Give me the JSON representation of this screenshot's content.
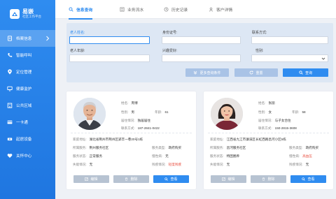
{
  "app": {
    "name": "易嵌",
    "subtitle": "社区工作平台"
  },
  "sidebar": {
    "items": [
      {
        "label": "档案信息",
        "icon": "file-icon",
        "active": true
      },
      {
        "label": "智能呼叫",
        "icon": "phone-icon"
      },
      {
        "label": "定位管理",
        "icon": "location-icon"
      },
      {
        "label": "健康监护",
        "icon": "monitor-icon"
      },
      {
        "label": "公共区域",
        "icon": "building-icon"
      },
      {
        "label": "一卡通",
        "icon": "card-icon"
      },
      {
        "label": "起居设备",
        "icon": "device-icon"
      },
      {
        "label": "关怀中心",
        "icon": "heart-icon"
      }
    ]
  },
  "tabs": [
    {
      "label": "信息查询",
      "icon": "search-icon",
      "active": true
    },
    {
      "label": "业务流水",
      "icon": "list-icon"
    },
    {
      "label": "历史记录",
      "icon": "clock-icon"
    },
    {
      "label": "客户详情",
      "icon": "user-icon"
    }
  ],
  "search": {
    "fields": {
      "name": {
        "label": "老人姓名:",
        "value": ""
      },
      "idcard": {
        "label": "身份证号:",
        "value": ""
      },
      "contact": {
        "label": "联系方式:",
        "value": ""
      },
      "age": {
        "label": "老人年龄:",
        "value": ""
      },
      "hobby": {
        "label": "兴趣爱好:",
        "value": ""
      },
      "gender": {
        "label": "性别:",
        "value": ""
      }
    },
    "buttons": {
      "more": "更多查询条件",
      "reset": "重置",
      "query": "查询"
    }
  },
  "cards": [
    {
      "photo": "elderly-man-photo",
      "fields": {
        "name": {
          "label": "姓名:",
          "value": "周博"
        },
        "gender": {
          "label": "性别:",
          "value": "男"
        },
        "age": {
          "label": "年龄:",
          "value": "61"
        },
        "living": {
          "label": "居住情况:",
          "value": "独居居住"
        },
        "phone": {
          "label": "联系方式:",
          "value": "187-2841-0422"
        },
        "address": {
          "label": "家庭地址:",
          "value": "湖北省荆州市荆州区郢丰一巷20号1栋"
        },
        "community": {
          "label": "所属服务:",
          "value": "荆州服务社区"
        },
        "service_type": {
          "label": "服务类型:",
          "value": "政府购买"
        },
        "service_status": {
          "label": "服务状态:",
          "value": "正常服务"
        },
        "disease": {
          "label": "慢性病:",
          "value": "无"
        },
        "disability": {
          "label": "失能情况:",
          "value": "无"
        },
        "special": {
          "label": "残疾情况:",
          "value": "轻度残疾",
          "highlight": true
        }
      },
      "buttons": {
        "edit": "编辑",
        "delete": "删除",
        "view": "查看"
      }
    },
    {
      "photo": "elderly-woman-photo",
      "fields": {
        "name": {
          "label": "姓名:",
          "value": "张丽"
        },
        "gender": {
          "label": "性别:",
          "value": "女"
        },
        "age": {
          "label": "年龄:",
          "value": "58"
        },
        "living": {
          "label": "居住情况:",
          "value": "与子女合住"
        },
        "phone": {
          "label": "联系方式:",
          "value": "150-2815-3608"
        },
        "address": {
          "label": "家庭地址:",
          "value": "江西省九江市濂溪区长虹西路昌河小区5栋"
        },
        "community": {
          "label": "所属服务:",
          "value": "昌河服务社区"
        },
        "service_type": {
          "label": "服务类型:",
          "value": "政府购买"
        },
        "service_status": {
          "label": "服务状态:",
          "value": "特困圈养"
        },
        "disease": {
          "label": "慢性病:",
          "value": "高血压",
          "highlight": true
        },
        "disability": {
          "label": "失能情况:",
          "value": "无"
        },
        "special": {
          "label": "残疾情况:",
          "value": "无"
        }
      },
      "buttons": {
        "edit": "编辑",
        "delete": "删除",
        "view": "查看"
      }
    }
  ],
  "colors": {
    "primary": "#2f8cf0",
    "sidebar": "#2683ec",
    "danger": "#e84b3c"
  }
}
